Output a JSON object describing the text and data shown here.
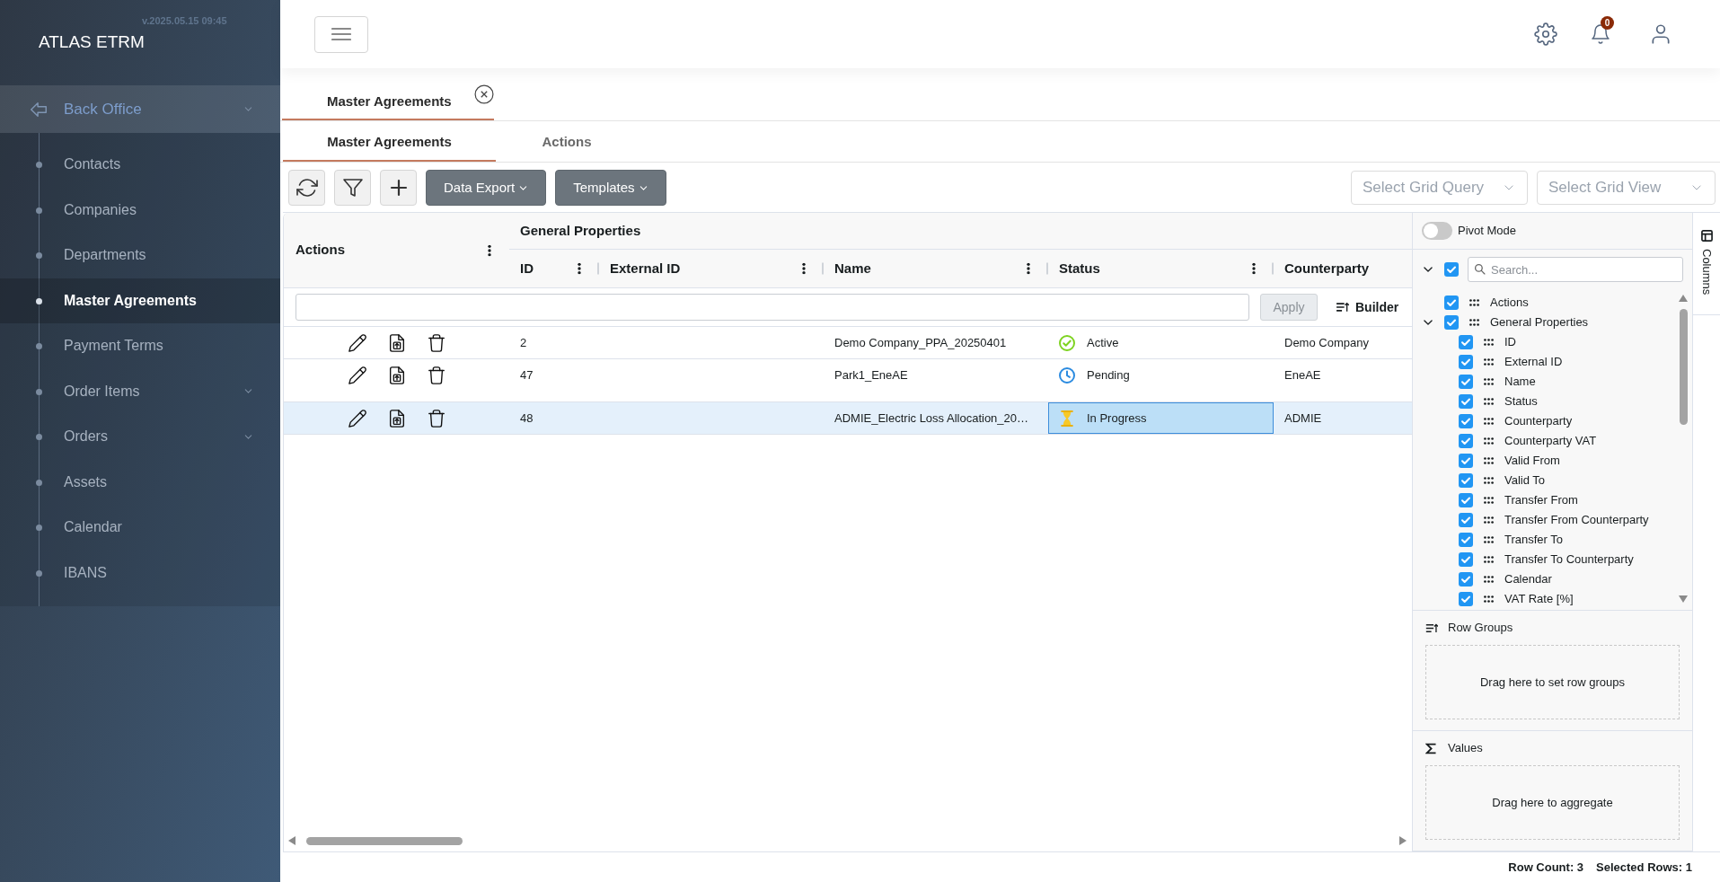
{
  "sidebar": {
    "brand": "ATLAS ETRM",
    "version": "v.2025.05.15 09:45",
    "section": "Back Office",
    "items": [
      {
        "label": "Contacts",
        "selected": false,
        "submenu": false
      },
      {
        "label": "Companies",
        "selected": false,
        "submenu": false
      },
      {
        "label": "Departments",
        "selected": false,
        "submenu": false
      },
      {
        "label": "Master Agreements",
        "selected": true,
        "submenu": false
      },
      {
        "label": "Payment Terms",
        "selected": false,
        "submenu": false
      },
      {
        "label": "Order Items",
        "selected": false,
        "submenu": true
      },
      {
        "label": "Orders",
        "selected": false,
        "submenu": true
      },
      {
        "label": "Assets",
        "selected": false,
        "submenu": false
      },
      {
        "label": "Calendar",
        "selected": false,
        "submenu": false
      },
      {
        "label": "IBANS",
        "selected": false,
        "submenu": false
      }
    ]
  },
  "header": {
    "notification_count": "0"
  },
  "page_tabs": [
    {
      "label": "Master Agreements",
      "selected": true
    }
  ],
  "sub_tabs": [
    {
      "label": "Master Agreements",
      "selected": true
    },
    {
      "label": "Actions",
      "selected": false
    }
  ],
  "toolbar": {
    "menus": [
      "Data Export",
      "Templates"
    ],
    "selects": [
      {
        "placeholder": "Select Grid Query"
      },
      {
        "placeholder": "Select Grid View"
      }
    ]
  },
  "grid": {
    "group_header": "General Properties",
    "columns": [
      "Actions",
      "ID",
      "External ID",
      "Name",
      "Status",
      "Counterparty"
    ],
    "filter_bar": {
      "apply": "Apply",
      "apply_disabled": true,
      "builder": "Builder"
    },
    "rows": [
      {
        "id": "2",
        "name": "Demo Company_PPA_20250401",
        "status": {
          "label": "Active",
          "kind": "active",
          "focused": false
        },
        "counterparty": "Demo Company",
        "selected": false
      },
      {
        "id": "47",
        "name": "Park1_EneAE",
        "status": {
          "label": "Pending",
          "kind": "pending",
          "focused": false
        },
        "counterparty": "EneAE",
        "selected": false
      },
      {
        "id": "48",
        "name": "ADMIE_Electric Loss Allocation_20…",
        "status": {
          "label": "In Progress",
          "kind": "in_progress",
          "focused": true
        },
        "counterparty": "ADMIE",
        "selected": true
      }
    ]
  },
  "column_panel": {
    "pivot_mode": {
      "label": "Pivot Mode",
      "on": false
    },
    "all_expanded": true,
    "all_checked": true,
    "search": {
      "placeholder": "Search..."
    },
    "columns": [
      {
        "label": "Actions",
        "kind": "column",
        "checked": true
      },
      {
        "label": "General Properties",
        "kind": "group",
        "checked": true,
        "expanded": true,
        "children": [
          {
            "label": "ID",
            "kind": "column",
            "checked": true
          },
          {
            "label": "External ID",
            "kind": "column",
            "checked": true
          },
          {
            "label": "Name",
            "kind": "column",
            "checked": true
          },
          {
            "label": "Status",
            "kind": "column",
            "checked": true
          },
          {
            "label": "Counterparty",
            "kind": "column",
            "checked": true
          },
          {
            "label": "Counterparty VAT",
            "kind": "column",
            "checked": true
          },
          {
            "label": "Valid From",
            "kind": "column",
            "checked": true
          },
          {
            "label": "Valid To",
            "kind": "column",
            "checked": true
          },
          {
            "label": "Transfer From",
            "kind": "column",
            "checked": true
          },
          {
            "label": "Transfer From Counterparty",
            "kind": "column",
            "checked": true
          },
          {
            "label": "Transfer To",
            "kind": "column",
            "checked": true
          },
          {
            "label": "Transfer To Counterparty",
            "kind": "column",
            "checked": true
          },
          {
            "label": "Calendar",
            "kind": "column",
            "checked": true
          },
          {
            "label": "VAT Rate [%]",
            "kind": "column",
            "checked": true
          }
        ]
      }
    ],
    "row_groups": {
      "title": "Row Groups",
      "hint": "Drag here to set row groups"
    },
    "values": {
      "title": "Values",
      "hint": "Drag here to aggregate"
    },
    "side_tab": "Columns"
  },
  "status_bar": [
    "Row Count: 3",
    "Selected Rows: 1"
  ]
}
